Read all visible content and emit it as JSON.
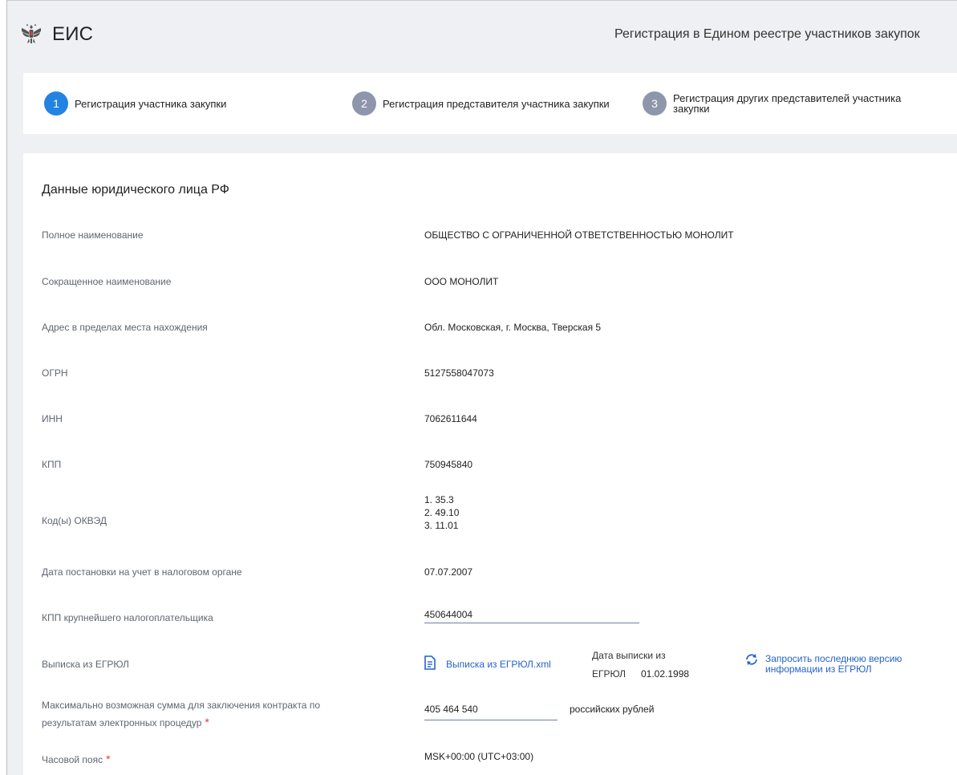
{
  "header": {
    "brand": "ЕИС",
    "page_heading": "Регистрация в Едином реестре участников закупок"
  },
  "steps": [
    {
      "num": "1",
      "label": "Регистрация участника закупки",
      "state": "active"
    },
    {
      "num": "2",
      "label": "Регистрация представителя участника закупки",
      "state": "inactive"
    },
    {
      "num": "3",
      "label": "Регистрация других представителей участника закупки",
      "state": "inactive"
    }
  ],
  "section": {
    "title": "Данные юридического лица РФ",
    "rows": {
      "full_name": {
        "label": "Полное наименование",
        "value": "ОБЩЕСТВО С ОГРАНИЧЕННОЙ ОТВЕТСТВЕННОСТЬЮ МОНОЛИТ"
      },
      "short_name": {
        "label": "Сокращенное наименование",
        "value": "ООО МОНОЛИТ"
      },
      "address": {
        "label": "Адрес в пределах места нахождения",
        "value": "Обл. Московская, г. Москва, Тверская 5"
      },
      "ogrn": {
        "label": "ОГРН",
        "value": "5127558047073"
      },
      "inn": {
        "label": "ИНН",
        "value": "7062611644"
      },
      "kpp": {
        "label": "КПП",
        "value": "750945840"
      },
      "okved": {
        "label": "Код(ы) ОКВЭД",
        "values": [
          "1. 35.3",
          "2. 49.10",
          "3. 11.01"
        ]
      },
      "tax_date": {
        "label": "Дата постановки на учет в налоговом органе",
        "value": "07.07.2007"
      },
      "largest_kpp": {
        "label": "КПП крупнейшего налогоплательщика",
        "value": "450644004"
      },
      "egrul": {
        "label": "Выписка из ЕГРЮЛ",
        "file_link": "Выписка из ЕГРЮЛ.xml",
        "date_label_line1": "Дата выписки из",
        "date_label_line2": "ЕГРЮЛ",
        "date_value": "01.02.1998",
        "refresh_line1": "Запросить последнюю версию",
        "refresh_line2": "информации из ЕГРЮЛ"
      },
      "max_sum": {
        "label_line1": "Максимально возможная сумма для заключения контракта по",
        "label_line2": "результатам электронных процедур",
        "value": "405 464 540",
        "unit": "российских рублей"
      },
      "timezone": {
        "label": "Часовой пояс",
        "value": "MSK+00:00 (UTC+03:00)"
      }
    }
  },
  "colors": {
    "accent": "#2383e2",
    "inactive_step": "#8d96ab",
    "link": "#2563c9",
    "required": "#e53935"
  }
}
